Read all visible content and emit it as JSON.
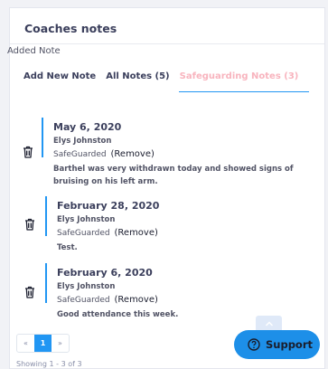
{
  "card": {
    "title": "Coaches notes"
  },
  "added_note_label": "Added Note",
  "tabs": [
    {
      "label": "Add New Note",
      "active": false
    },
    {
      "label": "All Notes (5)",
      "active": false
    },
    {
      "label": "Safeguarding Notes (3)",
      "active": true
    }
  ],
  "notes": [
    {
      "date": "May 6, 2020",
      "author": "Elys Johnston",
      "flag": "SafeGuarded",
      "action": "(Remove)",
      "text": "Barthel was very withdrawn today and showed signs of bruising on his left arm."
    },
    {
      "date": "February 28, 2020",
      "author": "Elys Johnston",
      "flag": "SafeGuarded",
      "action": "(Remove)",
      "text": "Test."
    },
    {
      "date": "February 6, 2020",
      "author": "Elys Johnston",
      "flag": "SafeGuarded",
      "action": "(Remove)",
      "text": "Good attendance this week."
    }
  ],
  "pagination": {
    "prev": "«",
    "current": "1",
    "next": "»"
  },
  "footer": {
    "text": "Showing 1 - 3 of 3"
  },
  "support_button": {
    "label": "Support"
  },
  "colors": {
    "accent": "#2196f3",
    "active_tab_text": "#f8b4be",
    "support_bg": "#1d8fe8"
  },
  "icons": {
    "delete": "trash-icon",
    "support": "question-circle-icon",
    "scroll_top": "chevron-up-icon"
  }
}
